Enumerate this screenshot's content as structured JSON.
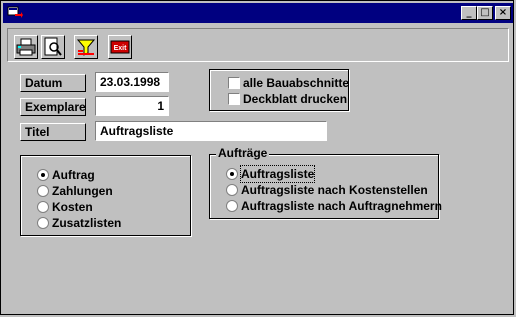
{
  "window": {
    "title": "",
    "system_icon": "app-icon",
    "controls": {
      "minimize": "_",
      "maximize": "□",
      "close": "×"
    }
  },
  "toolbar": {
    "buttons": [
      {
        "icon": "printer-icon"
      },
      {
        "icon": "print-preview-icon"
      },
      {
        "icon": "filter-icon"
      },
      {
        "icon": "exit-icon",
        "label": "Exit"
      }
    ]
  },
  "fields": {
    "datum": {
      "label": "Datum",
      "value": "23.03.1998"
    },
    "exemplare": {
      "label": "Exemplare",
      "value": "1"
    },
    "titel": {
      "label": "Titel",
      "value": "Auftragsliste"
    }
  },
  "checkboxes": [
    {
      "label": "alle Bauabschnitte",
      "checked": false
    },
    {
      "label": "Deckblatt drucken",
      "checked": false
    }
  ],
  "report_type": {
    "options": [
      {
        "label": "Auftrag",
        "selected": true
      },
      {
        "label": "Zahlungen",
        "selected": false
      },
      {
        "label": "Kosten",
        "selected": false
      },
      {
        "label": "Zusatzlisten",
        "selected": false
      }
    ]
  },
  "auftraege": {
    "title": "Aufträge",
    "options": [
      {
        "label": "Auftragsliste",
        "selected": true
      },
      {
        "label": "Auftragsliste nach Kostenstellen",
        "selected": false
      },
      {
        "label": "Auftragsliste nach Auftragnehmern",
        "selected": false
      }
    ]
  },
  "colors": {
    "titlebar": "#000080",
    "face": "#c0c0c0",
    "exit_button": "#cc0000"
  }
}
